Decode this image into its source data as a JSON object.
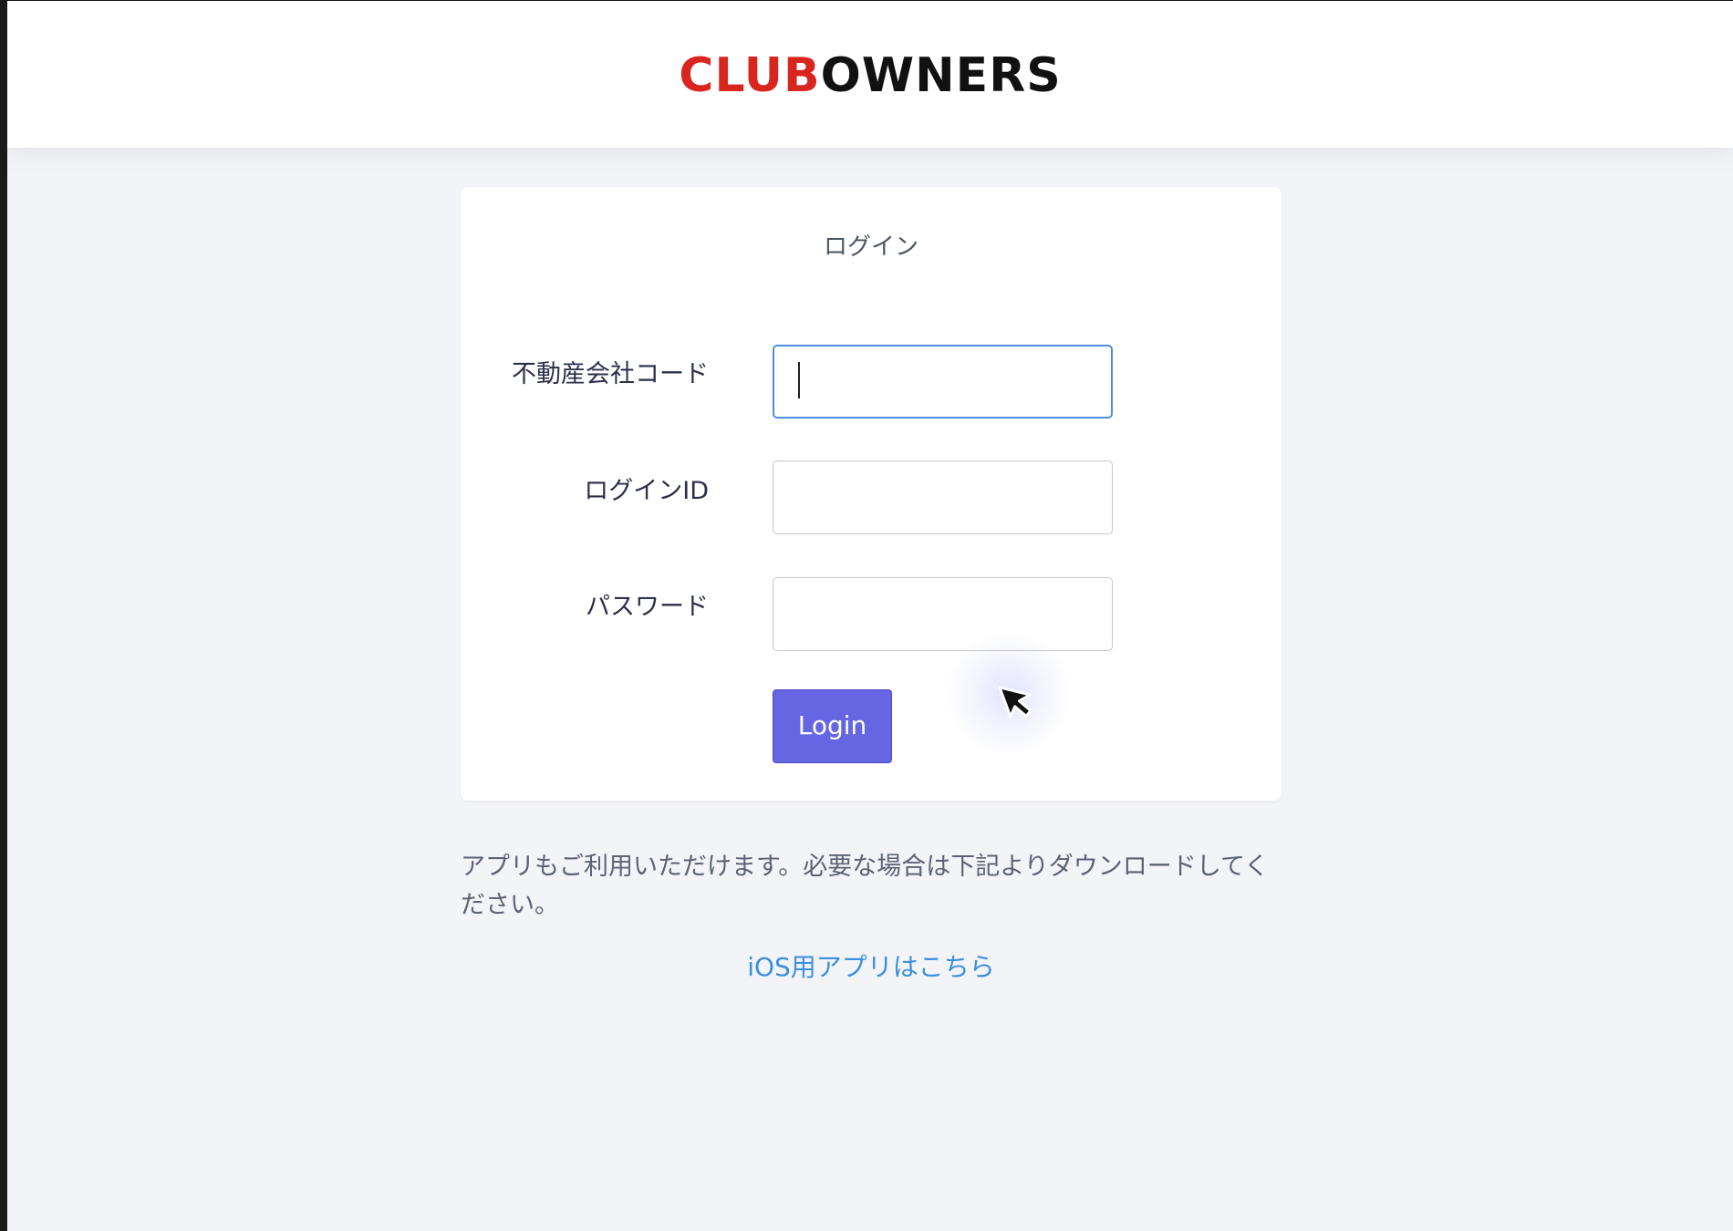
{
  "header": {
    "logo_part1": "CLUB",
    "logo_part2": "OWNERS",
    "logo_colors": {
      "club": "#d8261f",
      "owners": "#111111"
    }
  },
  "login_card": {
    "title": "ログイン",
    "fields": [
      {
        "label": "不動産会社コード",
        "value": "",
        "focused": true
      },
      {
        "label": "ログインID",
        "value": ""
      },
      {
        "label": "パスワード",
        "value": ""
      }
    ],
    "submit_label": "Login"
  },
  "app_notice": "アプリもご利用いただけます。必要な場合は下記よりダウンロードしてください。",
  "ios_link": "iOS用アプリはこちら",
  "colors": {
    "page_background": "#f3f4f8",
    "button": "#6666e2",
    "link": "#3b8fe0",
    "focus_border": "#4a90e2"
  },
  "icons": {
    "pointer": "mouse-pointer-icon"
  }
}
